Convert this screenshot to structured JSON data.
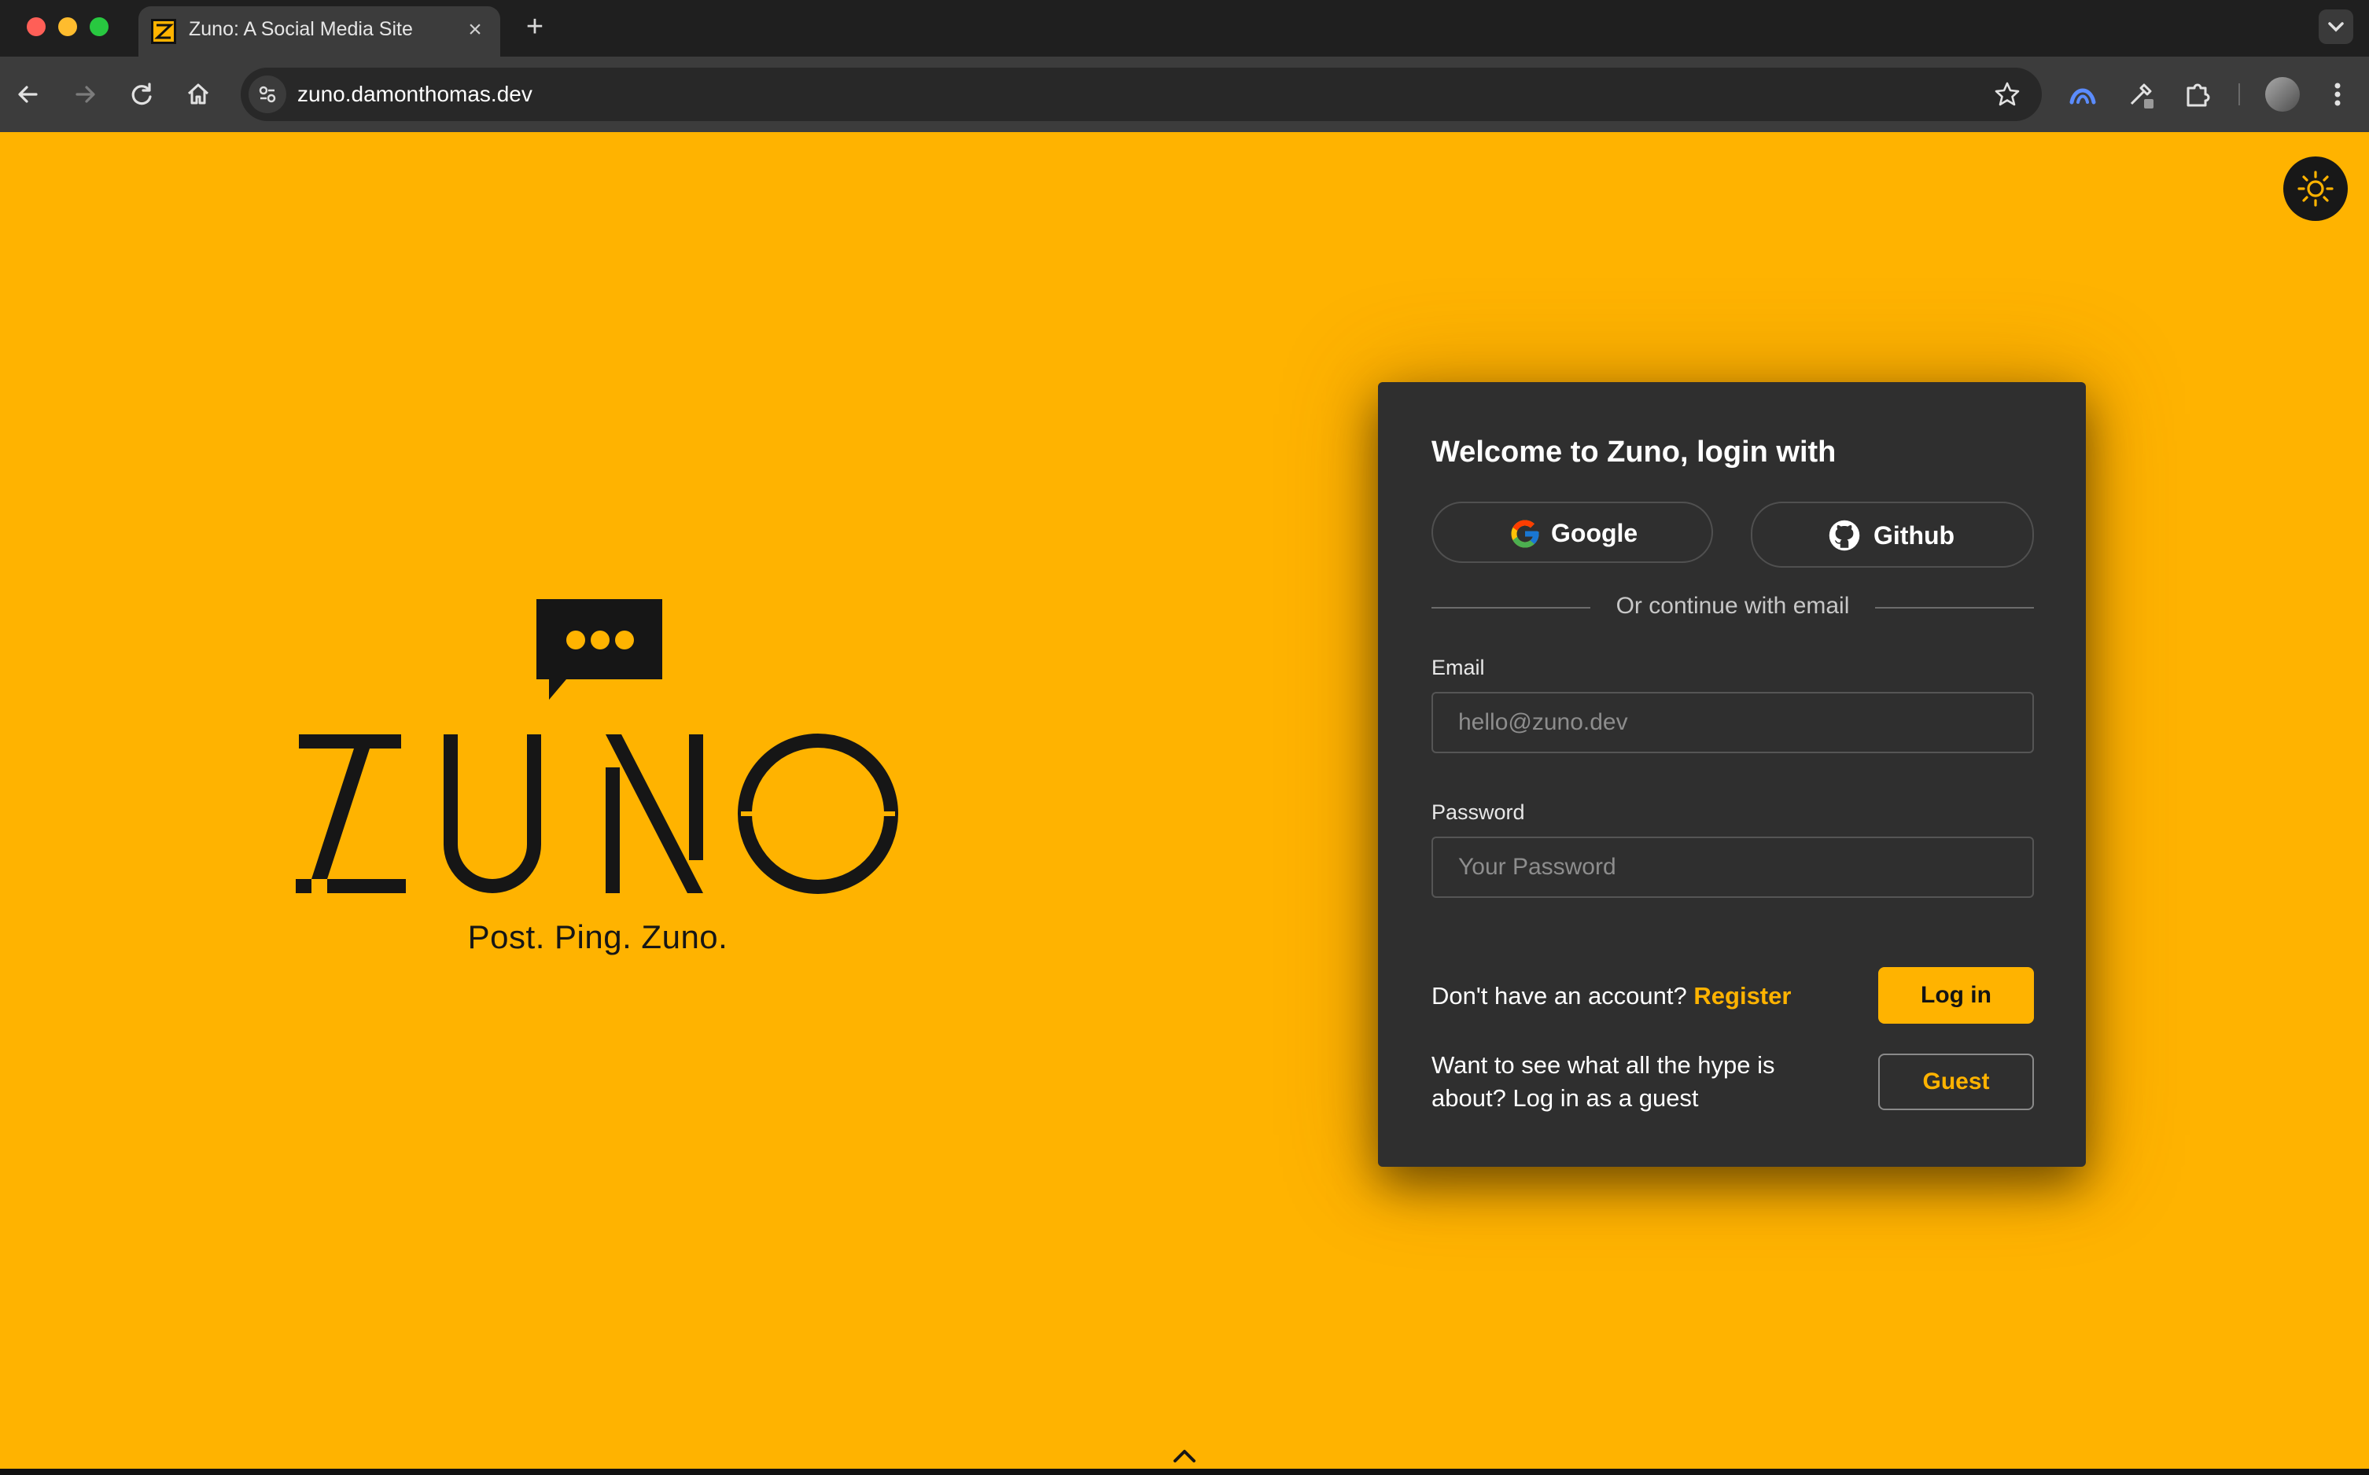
{
  "browser": {
    "tab": {
      "title": "Zuno: A Social Media Site"
    },
    "url": "zuno.damonthomas.dev"
  },
  "brand": {
    "wordmark": "ZUNO",
    "tagline": "Post. Ping. Zuno."
  },
  "login": {
    "title": "Welcome to Zuno, login with",
    "google_label": "Google",
    "github_label": "Github",
    "divider_text": "Or continue with email",
    "email_label": "Email",
    "email_placeholder": "hello@zuno.dev",
    "email_value": "",
    "password_label": "Password",
    "password_placeholder": "Your Password",
    "password_value": "",
    "no_account_text": "Don't have an account?",
    "register_label": "Register",
    "login_label": "Log in",
    "guest_text": "Want to see what all the hype is about? Log in as a guest",
    "guest_label": "Guest"
  },
  "icons": {
    "theme_toggle": "sun-icon",
    "google": "google-icon",
    "github": "github-icon",
    "scroll": "chevron-up-icon"
  },
  "colors": {
    "brand_yellow": "#ffb300",
    "card_bg": "#2f2f2f",
    "text_dark": "#161616"
  }
}
